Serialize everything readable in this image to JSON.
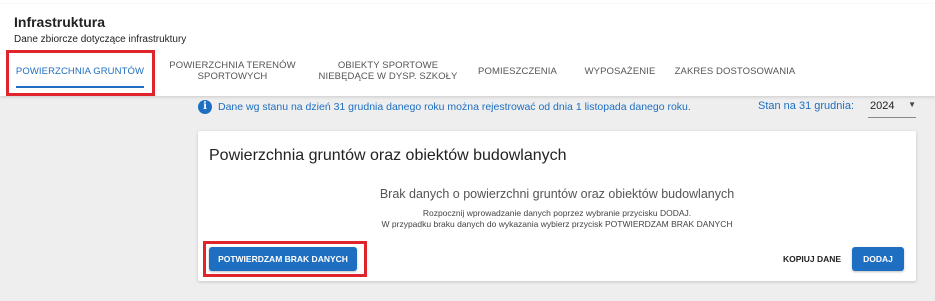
{
  "header": {
    "title": "Infrastruktura",
    "subtitle": "Dane zbiorcze dotyczące infrastruktury"
  },
  "tabs": [
    {
      "label": "POWIERZCHNIA GRUNTÓW",
      "active": true
    },
    {
      "line1": "POWIERZCHNIA TERENÓW",
      "line2": "SPORTOWYCH",
      "active": false
    },
    {
      "line1": "OBIEKTY SPORTOWE",
      "line2": "NIEBĘDĄCE W DYSP. SZKOŁY",
      "active": false
    },
    {
      "label": "POMIESZCZENIA",
      "active": false
    },
    {
      "label": "WYPOSAŻENIE",
      "active": false
    },
    {
      "label": "ZAKRES DOSTOSOWANIA",
      "active": false
    }
  ],
  "info": {
    "icon": "info-icon",
    "text": "Dane wg stanu na dzień 31 grudnia danego roku można rejestrować od dnia 1 listopada danego roku.",
    "year_label": "Stan na 31 grudnia:",
    "year_value": "2024"
  },
  "card": {
    "title": "Powierzchnia gruntów oraz obiektów budowlanych",
    "empty_title": "Brak danych o powierzchni gruntów oraz obiektów budowlanych",
    "empty_line1": "Rozpocznij wprowadzanie danych poprzez wybranie przycisku DODAJ.",
    "empty_line2": "W przypadku braku danych do wykazania wybierz przycisk POTWIERDZAM BRAK DANYCH",
    "confirm_label": "POTWIERDZAM BRAK DANYCH",
    "copy_label": "KOPIUJ DANE",
    "add_label": "DODAJ"
  },
  "colors": {
    "accent": "#1e6fc2",
    "highlight": "#e0242c"
  }
}
